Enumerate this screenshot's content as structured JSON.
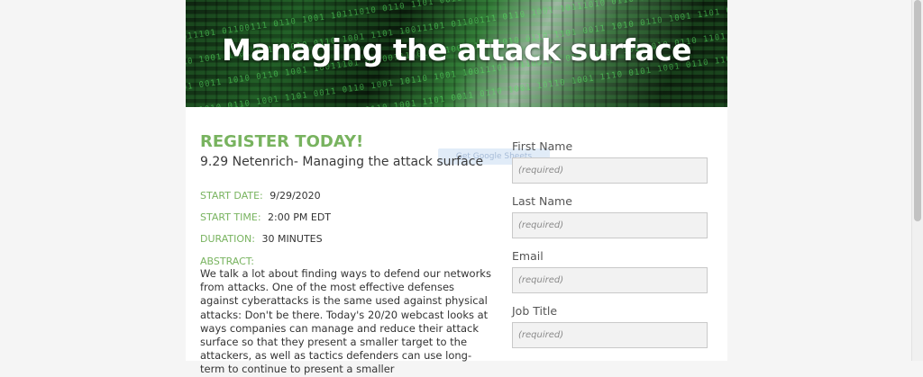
{
  "banner": {
    "title": "Managing the attack surface"
  },
  "event": {
    "heading": "REGISTER TODAY!",
    "title": "9.29 Netenrich- Managing the attack surface",
    "start_date_label": "START DATE:",
    "start_date": "9/29/2020",
    "start_time_label": "START TIME:",
    "start_time": "2:00 PM EDT",
    "duration_label": "DURATION:",
    "duration": "30 MINUTES",
    "abstract_label": "ABSTRACT:",
    "abstract": "We talk a lot about finding ways to defend our networks from attacks. One of the most effective defenses against cyberattacks is the same used against physical attacks: Don't be there. Today's 20/20 webcast looks at ways companies can manage and reduce their attack surface so that they present a smaller target to the attackers, as well as tactics defenders can use long-term to continue to present a smaller"
  },
  "overlay": {
    "ghost_button_label": "Get Google Sheets"
  },
  "form": {
    "fields": [
      {
        "label": "First Name",
        "placeholder": "(required)"
      },
      {
        "label": "Last Name",
        "placeholder": "(required)"
      },
      {
        "label": "Email",
        "placeholder": "(required)"
      },
      {
        "label": "Job Title",
        "placeholder": "(required)"
      }
    ]
  },
  "colors": {
    "accent_green": "#78b35f",
    "page_background": "#f5f5f5",
    "input_background": "#f2f2f2"
  }
}
